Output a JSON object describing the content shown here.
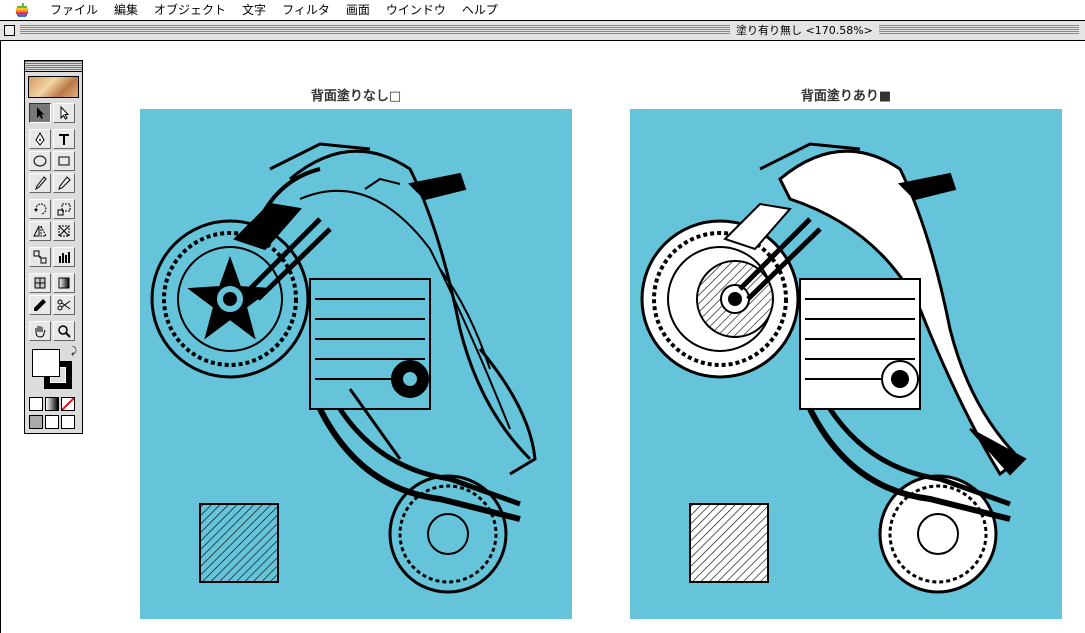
{
  "menubar": {
    "items": [
      "ファイル",
      "編集",
      "オブジェクト",
      "文字",
      "フィルタ",
      "画面",
      "ウインドウ",
      "ヘルプ"
    ]
  },
  "window": {
    "title": "塗り有り無し <170.58%>"
  },
  "toolbox": {
    "tools": [
      "selection-tool",
      "direct-selection-tool",
      "pen-tool",
      "type-tool",
      "ellipse-tool",
      "rectangle-tool",
      "paintbrush-tool",
      "pencil-tool",
      "rotate-tool",
      "scale-tool",
      "reflect-tool",
      "free-transform-tool",
      "blend-tool",
      "graph-tool",
      "gradient-mesh-tool",
      "gradient-tool",
      "eyedropper-tool",
      "scissors-tool",
      "hand-tool",
      "zoom-tool"
    ]
  },
  "artwork": {
    "left_caption": "背面塗りなし□",
    "right_caption": "背面塗りあり■",
    "background_color": "#65c4da"
  }
}
